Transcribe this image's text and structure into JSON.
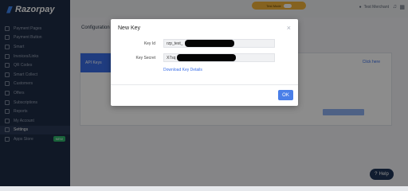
{
  "brand": {
    "logo_text": "Razorpay"
  },
  "sidebar": {
    "items": [
      {
        "label": "Payment Pages"
      },
      {
        "label": "Payment Button"
      },
      {
        "label": "Smart"
      },
      {
        "label": "Invoices/Links"
      },
      {
        "label": "QR Codes"
      },
      {
        "label": "Smart Collect"
      },
      {
        "label": "Customers"
      },
      {
        "label": "Offers"
      },
      {
        "label": "Subscriptions"
      },
      {
        "label": "Reports"
      },
      {
        "label": "My Account"
      },
      {
        "label": "Settings"
      },
      {
        "label": "Apps Store",
        "badge": "NEW"
      }
    ]
  },
  "topbar": {
    "mode_label": "Test Mode",
    "user_label": "Test Merchant"
  },
  "page": {
    "title": "Configuration",
    "tab_label": "API Keys",
    "right_link": "Click here"
  },
  "modal": {
    "title": "New Key",
    "close_icon": "close-icon",
    "key_id_label": "Key Id",
    "key_id_value": "rzp_test_",
    "key_secret_label": "Key Secret",
    "key_secret_value": "X7sq",
    "download_link": "Download Key Details",
    "ok_label": "OK"
  },
  "help": {
    "label": "Help"
  },
  "colors": {
    "sidebar_bg": "#1e2c46",
    "accent": "#4a7fe8",
    "test_mode": "#f2b33a",
    "overlay": "rgba(0,0,0,0.45)"
  }
}
